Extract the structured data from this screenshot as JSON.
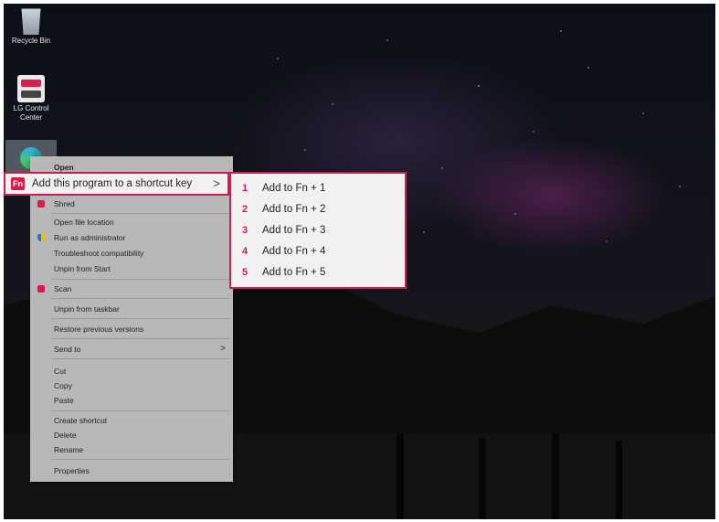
{
  "desktop": {
    "icons": [
      {
        "label": "Recycle Bin",
        "icon": "recycle-bin-icon"
      },
      {
        "label": "LG Control Center",
        "icon": "lg-control-center-icon"
      },
      {
        "label": "",
        "icon": "edge-browser-icon"
      }
    ]
  },
  "context_menu": {
    "open": "Open",
    "highlighted": {
      "badge": "Fn",
      "label": "Add this program to a shortcut key",
      "arrow": ">"
    },
    "shred": "Shred",
    "open_file_location": "Open file location",
    "run_as_admin": "Run as administrator",
    "troubleshoot": "Troubleshoot compatibility",
    "unpin_start": "Unpin from Start",
    "scan": "Scan",
    "unpin_taskbar": "Unpin from taskbar",
    "restore": "Restore previous versions",
    "send_to": "Send to",
    "send_to_arrow": ">",
    "cut": "Cut",
    "copy": "Copy",
    "paste": "Paste",
    "create_shortcut": "Create shortcut",
    "delete": "Delete",
    "rename": "Rename",
    "properties": "Properties"
  },
  "submenu": {
    "items": [
      {
        "num": "1",
        "label": "Add to Fn + 1"
      },
      {
        "num": "2",
        "label": "Add to Fn + 2"
      },
      {
        "num": "3",
        "label": "Add to Fn + 3"
      },
      {
        "num": "4",
        "label": "Add to Fn + 4"
      },
      {
        "num": "5",
        "label": "Add to Fn + 5"
      }
    ]
  },
  "colors": {
    "accent": "#d91a4a",
    "highlight_border": "#c8214f",
    "menu_bg": "#b8b8b8"
  }
}
